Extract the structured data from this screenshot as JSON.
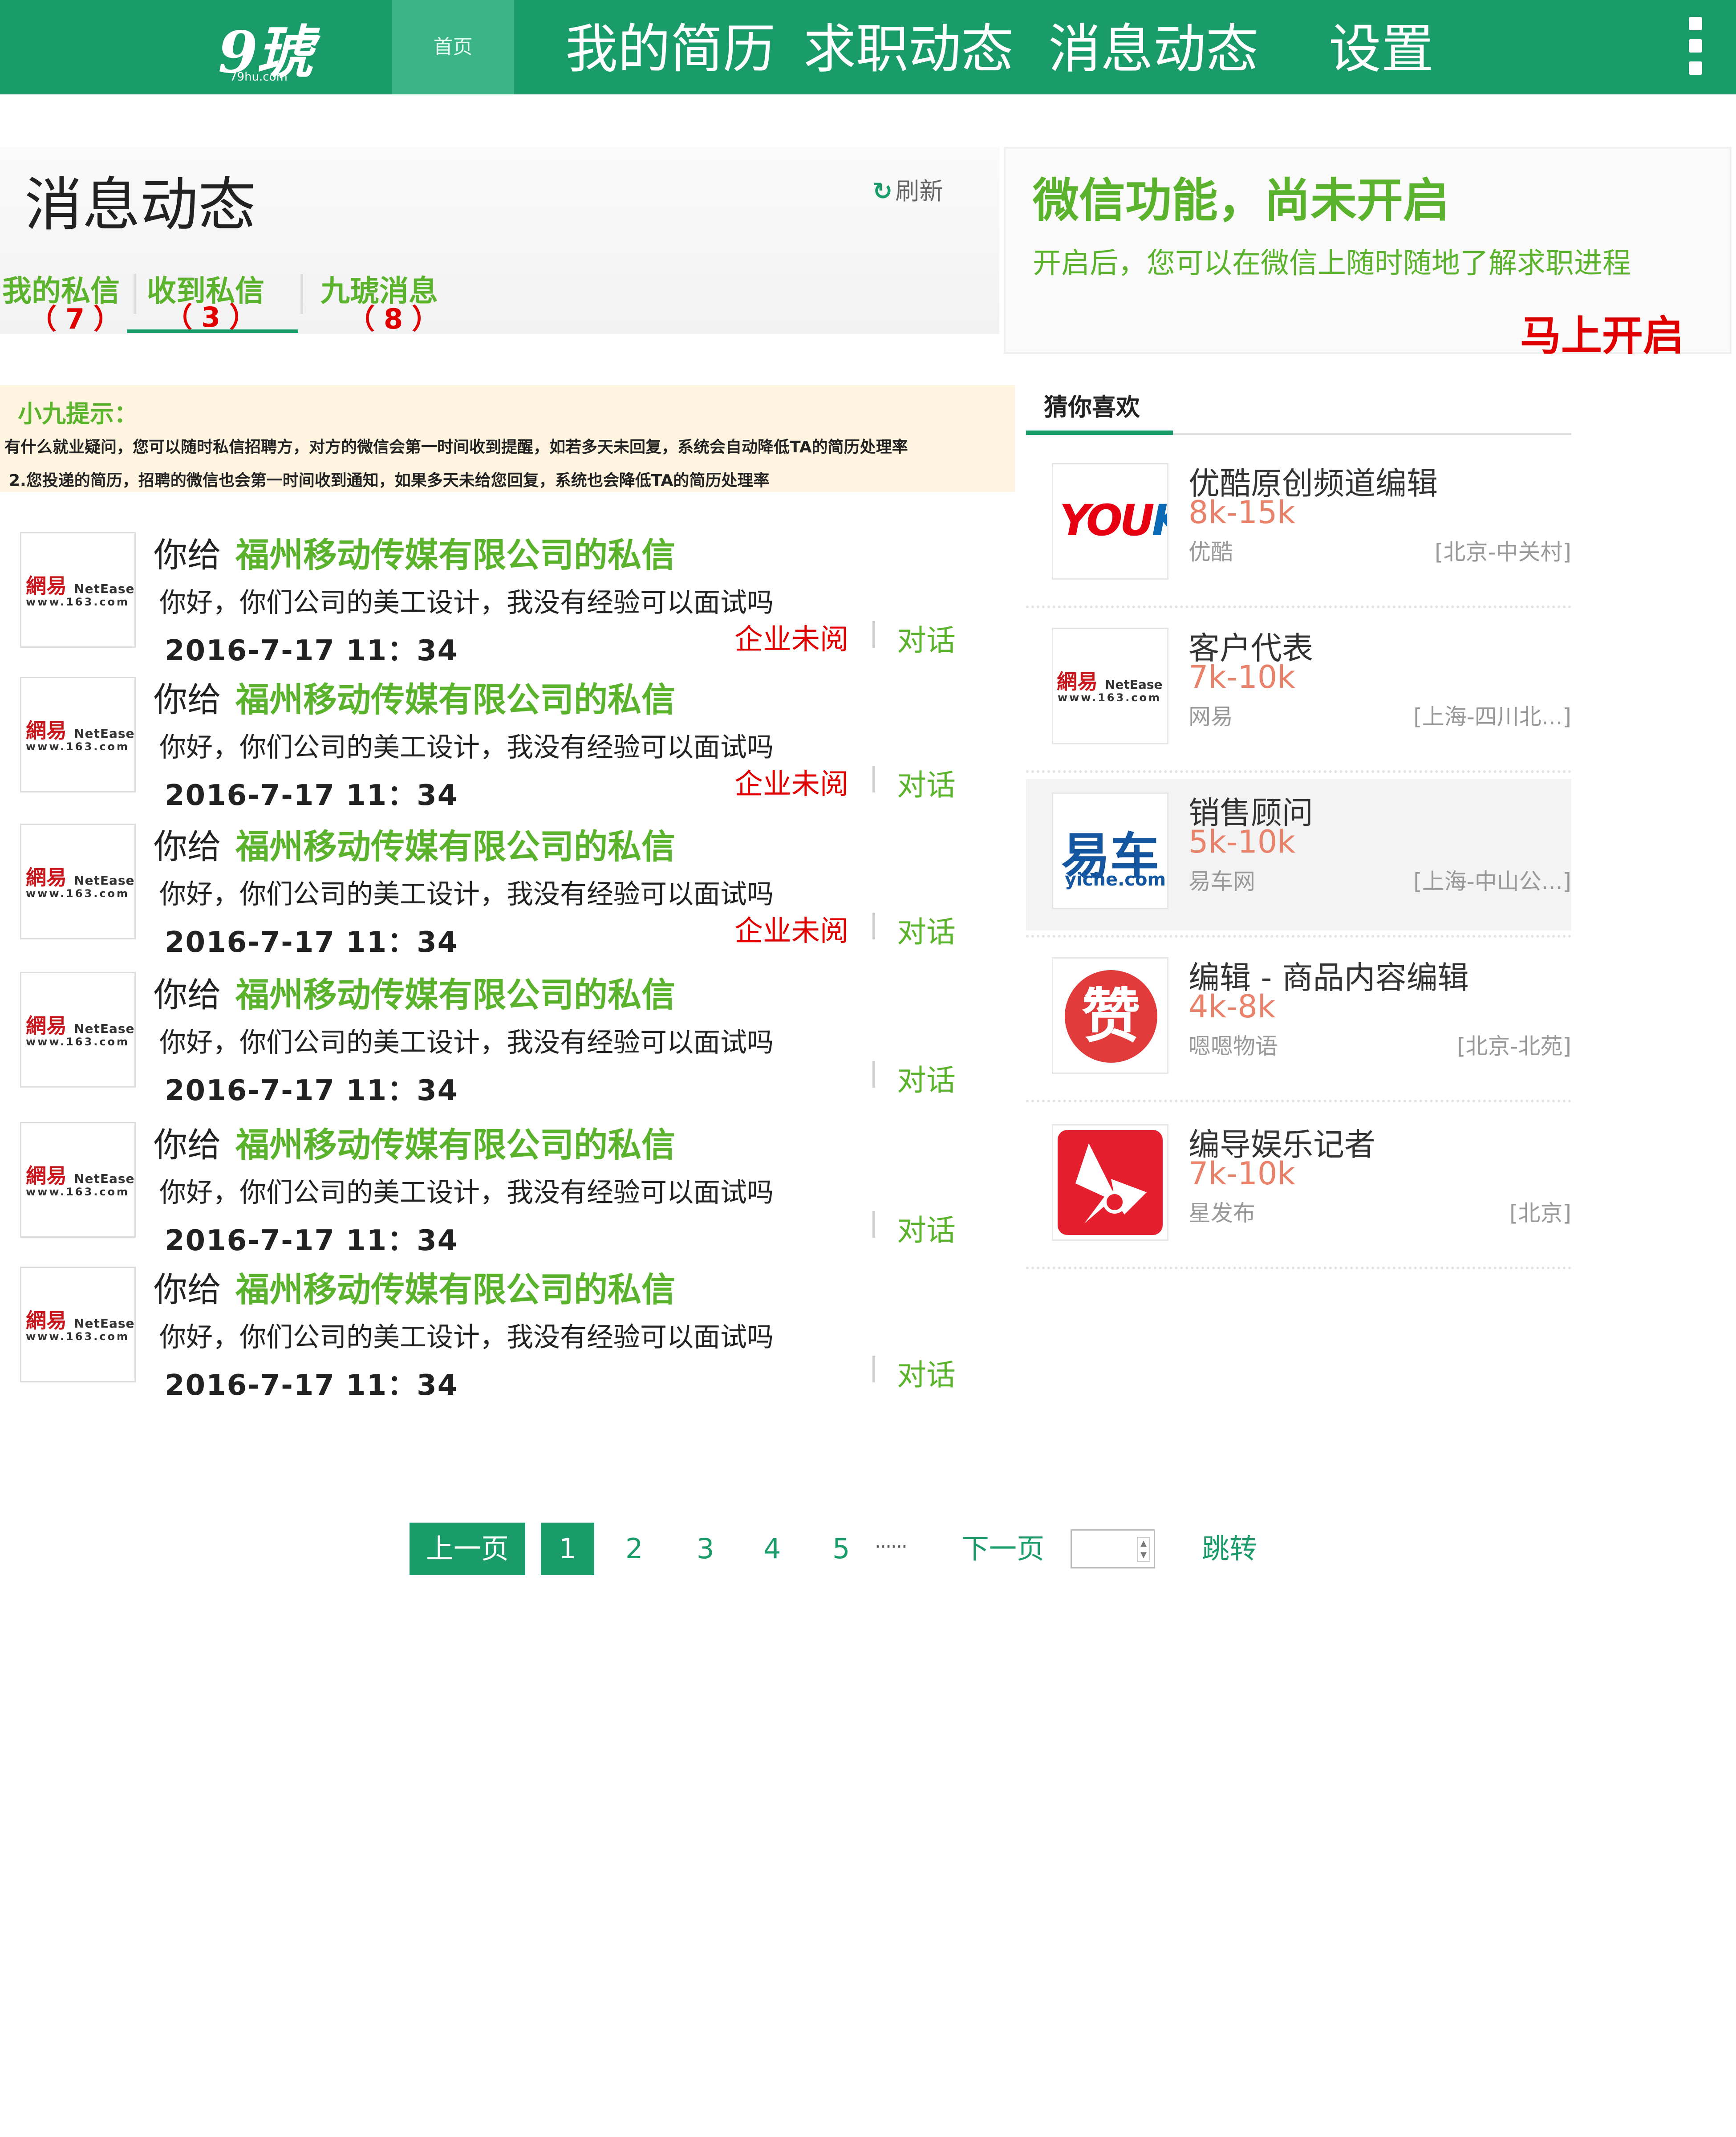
{
  "header": {
    "logo_text": "9琥",
    "logo_sub": "79hu.com",
    "home_tab": "首页",
    "nav": [
      "我的简历",
      "求职动态",
      "消息动态",
      "设置"
    ]
  },
  "page": {
    "title": "消息动态",
    "refresh_label": "刷新"
  },
  "tabs": [
    {
      "label": "我的私信",
      "count": "（7）"
    },
    {
      "label": "收到私信",
      "count": "（3）"
    },
    {
      "label": "九琥消息",
      "count": "（8）"
    }
  ],
  "tip": {
    "title": "小九提示：",
    "line1": "有什么就业疑问，您可以随时私信招聘方，对方的微信会第一时间收到提醒，如若多天未回复，系统会自动降低TA的简历处理率",
    "line2": "2.您投递的简历，招聘的微信也会第一时间收到通知，如果多天未给您回复，系统也会降低TA的简历处理率"
  },
  "messages": [
    {
      "prefix": "你给",
      "company": "福州移动传媒有限公司的私信",
      "text": "你好，你们公司的美工设计，我没有经验可以面试吗",
      "time": "2016-7-17 11：34",
      "status": "企业未阅",
      "action": "对话",
      "logo_cn": "網易",
      "logo_en": "NetEase",
      "logo_url": "www.163.com"
    },
    {
      "prefix": "你给",
      "company": "福州移动传媒有限公司的私信",
      "text": "你好，你们公司的美工设计，我没有经验可以面试吗",
      "time": "2016-7-17 11：34",
      "status": "企业未阅",
      "action": "对话",
      "logo_cn": "網易",
      "logo_en": "NetEase",
      "logo_url": "www.163.com"
    },
    {
      "prefix": "你给",
      "company": "福州移动传媒有限公司的私信",
      "text": "你好，你们公司的美工设计，我没有经验可以面试吗",
      "time": "2016-7-17 11：34",
      "status": "企业未阅",
      "action": "对话",
      "logo_cn": "網易",
      "logo_en": "NetEase",
      "logo_url": "www.163.com"
    },
    {
      "prefix": "你给",
      "company": "福州移动传媒有限公司的私信",
      "text": "你好，你们公司的美工设计，我没有经验可以面试吗",
      "time": "2016-7-17 11：34",
      "status": "",
      "action": "对话",
      "logo_cn": "網易",
      "logo_en": "NetEase",
      "logo_url": "www.163.com"
    },
    {
      "prefix": "你给",
      "company": "福州移动传媒有限公司的私信",
      "text": "你好，你们公司的美工设计，我没有经验可以面试吗",
      "time": "2016-7-17 11：34",
      "status": "",
      "action": "对话",
      "logo_cn": "網易",
      "logo_en": "NetEase",
      "logo_url": "www.163.com"
    },
    {
      "prefix": "你给",
      "company": "福州移动传媒有限公司的私信",
      "text": "你好，你们公司的美工设计，我没有经验可以面试吗",
      "time": "2016-7-17 11：34",
      "status": "",
      "action": "对话",
      "logo_cn": "網易",
      "logo_en": "NetEase",
      "logo_url": "www.163.com"
    }
  ],
  "pagination": {
    "prev": "上一页",
    "pages": [
      "1",
      "2",
      "3",
      "4",
      "5"
    ],
    "current": "1",
    "ellipsis": "······",
    "next": "下一页",
    "jump": "跳转"
  },
  "wechat": {
    "title": "微信功能，尚未开启",
    "desc": "开启后，您可以在微信上随时随地了解求职进程",
    "action": "马上开启"
  },
  "recommend": {
    "title": "猜你喜欢",
    "jobs": [
      {
        "title": "优酷原创频道编辑",
        "salary": "8k-15k",
        "company": "优酷",
        "location": "[北京-中关村]",
        "logo": "youku-logo",
        "logo_text_a": "YOU",
        "logo_text_b": "KU"
      },
      {
        "title": "客户代表",
        "salary": "7k-10k",
        "company": "网易",
        "location": "[上海-四川北...]",
        "logo": "netease-logo",
        "logo_cn": "網易",
        "logo_en": "NetEase",
        "logo_url": "www.163.com"
      },
      {
        "title": "销售顾问",
        "salary": "5k-10k",
        "company": "易车网",
        "location": "[上海-中山公...]",
        "logo": "yiche-logo",
        "logo_cn": "易车",
        "logo_en": "yiche.com"
      },
      {
        "title": "编辑 - 商品内容编辑",
        "salary": "4k-8k",
        "company": "嗯嗯物语",
        "location": "[北京-北苑]",
        "logo": "zan-logo",
        "logo_cn": "赞"
      },
      {
        "title": "编导娱乐记者",
        "salary": "7k-10k",
        "company": "星发布",
        "location": "[北京]",
        "logo": "star-logo"
      }
    ]
  },
  "colors": {
    "brand_green": "#1a9c6a",
    "text_green": "#5bb32d",
    "alert_red": "#e00000",
    "salary_orange": "#e8826a",
    "tip_bg": "#fff4df"
  }
}
